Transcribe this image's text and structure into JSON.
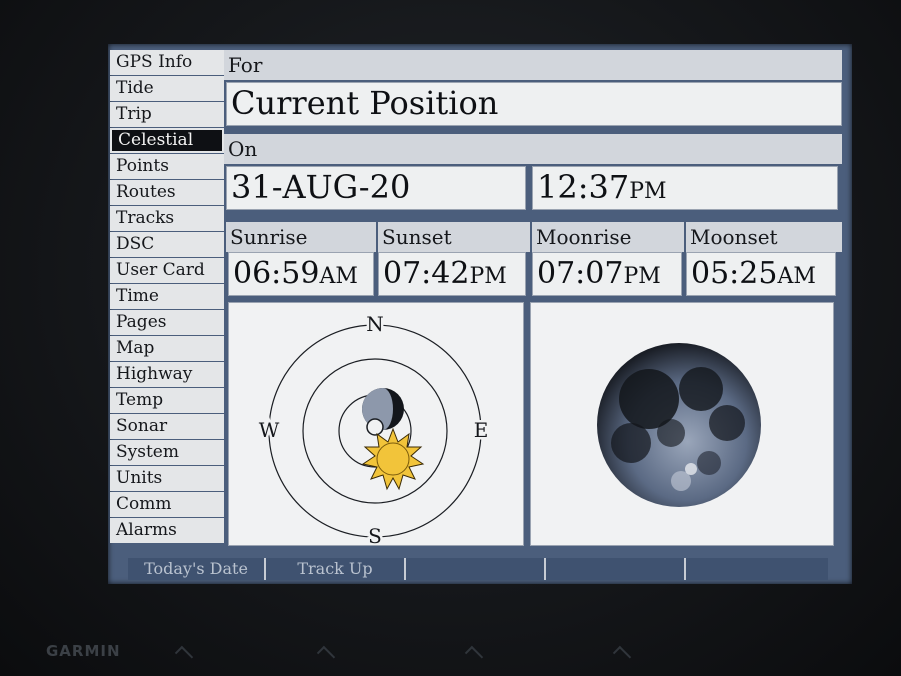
{
  "sidebar": {
    "items": [
      {
        "label": "GPS Info",
        "active": false
      },
      {
        "label": "Tide",
        "active": false
      },
      {
        "label": "Trip",
        "active": false
      },
      {
        "label": "Celestial",
        "active": true
      },
      {
        "label": "Points",
        "active": false
      },
      {
        "label": "Routes",
        "active": false
      },
      {
        "label": "Tracks",
        "active": false
      },
      {
        "label": "DSC",
        "active": false
      },
      {
        "label": "User Card",
        "active": false
      },
      {
        "label": "Time",
        "active": false
      },
      {
        "label": "Pages",
        "active": false
      },
      {
        "label": "Map",
        "active": false
      },
      {
        "label": "Highway",
        "active": false
      },
      {
        "label": "Temp",
        "active": false
      },
      {
        "label": "Sonar",
        "active": false
      },
      {
        "label": "System",
        "active": false
      },
      {
        "label": "Units",
        "active": false
      },
      {
        "label": "Comm",
        "active": false
      },
      {
        "label": "Alarms",
        "active": false
      }
    ]
  },
  "main": {
    "for_label": "For",
    "position_value": "Current Position",
    "on_label": "On",
    "date_value": "31-AUG-20",
    "time_value": "12:37",
    "time_suffix": "PM",
    "times": {
      "sunrise": {
        "label": "Sunrise",
        "value": "06:59",
        "suffix": "AM"
      },
      "sunset": {
        "label": "Sunset",
        "value": "07:42",
        "suffix": "PM"
      },
      "moonrise": {
        "label": "Moonrise",
        "value": "07:07",
        "suffix": "PM"
      },
      "moonset": {
        "label": "Moonset",
        "value": "05:25",
        "suffix": "AM"
      }
    },
    "compass": {
      "n": "N",
      "s": "S",
      "e": "E",
      "w": "W"
    }
  },
  "softkeys": {
    "todays_date": "Today's Date",
    "track_up": "Track Up"
  },
  "colors": {
    "screen_bg": "#4b5e7c",
    "panel_bg": "#f1f2f3",
    "sun": "#f2c43a",
    "moon_dark": "#13161b"
  },
  "brand": "GARMIN"
}
